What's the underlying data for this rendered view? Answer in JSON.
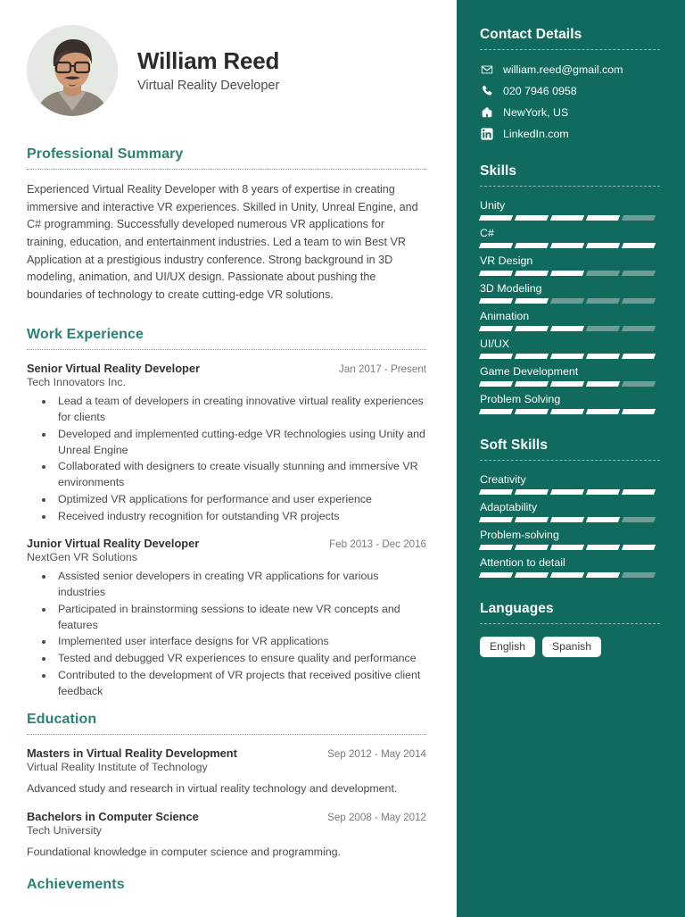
{
  "profile": {
    "name": "William Reed",
    "role": "Virtual Reality Developer",
    "avatar_icon": "profile-photo"
  },
  "sections": {
    "summary_title": "Professional Summary",
    "summary_text": "Experienced Virtual Reality Developer with 8 years of expertise in creating immersive and interactive VR experiences. Skilled in Unity, Unreal Engine, and C# programming. Successfully developed numerous VR applications for training, education, and entertainment industries. Led a team to win Best VR Application at a prestigious industry conference. Strong background in 3D modeling, animation, and UI/UX design. Passionate about pushing the boundaries of technology to create cutting-edge VR solutions.",
    "work_title": "Work Experience",
    "education_title": "Education",
    "achievements_title": "Achievements"
  },
  "experience": [
    {
      "title": "Senior Virtual Reality Developer",
      "date": "Jan 2017 - Present",
      "company": "Tech Innovators Inc.",
      "bullets": [
        "Lead a team of developers in creating innovative virtual reality experiences for clients",
        "Developed and implemented cutting-edge VR technologies using Unity and Unreal Engine",
        "Collaborated with designers to create visually stunning and immersive VR environments",
        "Optimized VR applications for performance and user experience",
        "Received industry recognition for outstanding VR projects"
      ]
    },
    {
      "title": "Junior Virtual Reality Developer",
      "date": "Feb 2013 - Dec 2016",
      "company": "NextGen VR Solutions",
      "bullets": [
        "Assisted senior developers in creating VR applications for various industries",
        "Participated in brainstorming sessions to ideate new VR concepts and features",
        "Implemented user interface designs for VR applications",
        "Tested and debugged VR experiences to ensure quality and performance",
        "Contributed to the development of VR projects that received positive client feedback"
      ]
    }
  ],
  "education": [
    {
      "degree": "Masters in Virtual Reality Development",
      "date": "Sep 2012 - May 2014",
      "school": "Virtual Reality Institute of Technology",
      "description": "Advanced study and research in virtual reality technology and development."
    },
    {
      "degree": "Bachelors in Computer Science",
      "date": "Sep 2008 - May 2012",
      "school": "Tech University",
      "description": "Foundational knowledge in computer science and programming."
    }
  ],
  "sidebar": {
    "contact_title": "Contact Details",
    "contacts": [
      {
        "icon": "envelope-icon",
        "text": "william.reed@gmail.com"
      },
      {
        "icon": "phone-icon",
        "text": "020 7946 0958"
      },
      {
        "icon": "home-icon",
        "text": "NewYork, US"
      },
      {
        "icon": "linkedin-icon",
        "text": "LinkedIn.com"
      }
    ],
    "skills_title": "Skills",
    "skills": [
      {
        "name": "Unity",
        "level": 4,
        "max": 5
      },
      {
        "name": "C#",
        "level": 5,
        "max": 5
      },
      {
        "name": "VR Design",
        "level": 3,
        "max": 5
      },
      {
        "name": "3D Modeling",
        "level": 2,
        "max": 5
      },
      {
        "name": "Animation",
        "level": 3,
        "max": 5
      },
      {
        "name": "UI/UX",
        "level": 5,
        "max": 5
      },
      {
        "name": "Game Development",
        "level": 4,
        "max": 5
      },
      {
        "name": "Problem Solving",
        "level": 5,
        "max": 5
      }
    ],
    "soft_skills_title": "Soft Skills",
    "soft_skills": [
      {
        "name": "Creativity",
        "level": 5,
        "max": 5
      },
      {
        "name": "Adaptability",
        "level": 4,
        "max": 5
      },
      {
        "name": "Problem-solving",
        "level": 5,
        "max": 5
      },
      {
        "name": "Attention to detail",
        "level": 4,
        "max": 5
      }
    ],
    "languages_title": "Languages",
    "languages": [
      "English",
      "Spanish"
    ]
  },
  "colors": {
    "sidebar_bg": "#106b5e",
    "heading_teal": "#2b8274",
    "bar_filled": "#ffffff",
    "bar_empty": "#6e9d95",
    "body_text": "#4a4a4a"
  }
}
